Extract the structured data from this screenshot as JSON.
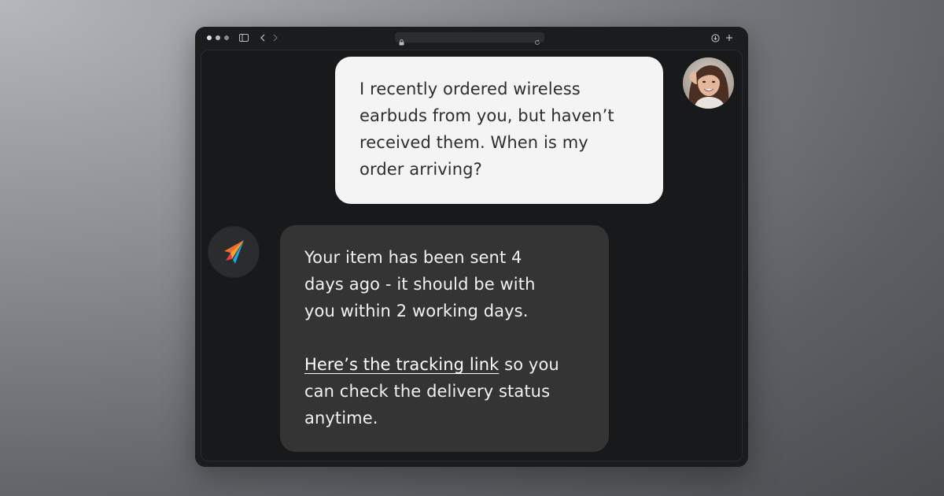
{
  "colors": {
    "window_bg": "#1b1c1e",
    "user_bubble": "#f4f4f4",
    "bot_bubble": "#343434",
    "logo_orange": "#f36b2a",
    "logo_blue": "#1aa6e8"
  },
  "icons": {
    "sidebar": "sidebar-toggle-icon",
    "back": "chevron-left-icon",
    "forward": "chevron-right-icon",
    "lock": "lock-icon",
    "reload": "reload-icon",
    "download": "download-icon",
    "new_tab": "plus-icon"
  },
  "chat": {
    "user_message": {
      "lines": [
        "I recently ordered wireless",
        "earbuds from you, but haven’t",
        "received them. When is my",
        "order arriving?"
      ]
    },
    "bot_message": {
      "paragraph1": [
        "Your item has been sent 4",
        "days ago - it should be with",
        "you within 2 working days."
      ],
      "link_text": "Here’s the tracking link",
      "after_link": " so you",
      "paragraph2_rest": [
        "can check the delivery status",
        "anytime."
      ]
    }
  }
}
